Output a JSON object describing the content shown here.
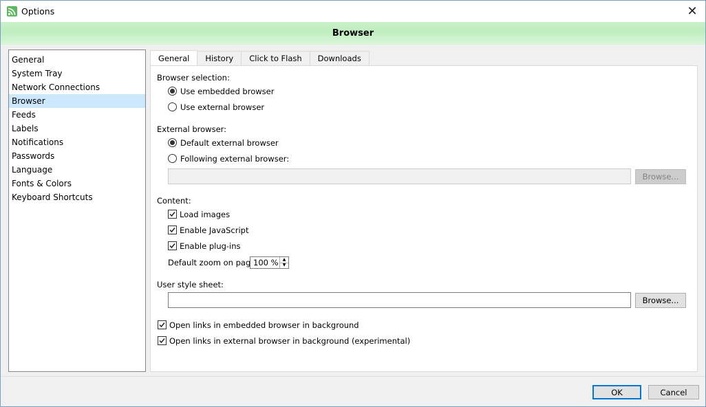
{
  "window": {
    "title": "Options",
    "close_glyph": "✕"
  },
  "header": {
    "title": "Browser"
  },
  "sidebar": {
    "items": [
      {
        "label": "General"
      },
      {
        "label": "System Tray"
      },
      {
        "label": "Network Connections"
      },
      {
        "label": "Browser",
        "selected": true
      },
      {
        "label": "Feeds"
      },
      {
        "label": "Labels"
      },
      {
        "label": "Notifications"
      },
      {
        "label": "Passwords"
      },
      {
        "label": "Language"
      },
      {
        "label": "Fonts & Colors"
      },
      {
        "label": "Keyboard Shortcuts"
      }
    ]
  },
  "tabs": [
    {
      "label": "General",
      "active": true
    },
    {
      "label": "History"
    },
    {
      "label": "Click to Flash"
    },
    {
      "label": "Downloads"
    }
  ],
  "browser_selection": {
    "heading": "Browser selection:",
    "embedded": {
      "label": "Use embedded browser",
      "checked": true
    },
    "external": {
      "label": "Use external browser",
      "checked": false
    }
  },
  "external_browser": {
    "heading": "External browser:",
    "default": {
      "label": "Default external browser",
      "checked": true
    },
    "following": {
      "label": "Following external browser:",
      "checked": false
    },
    "path_value": "",
    "browse_label": "Browse..."
  },
  "content": {
    "heading": "Content:",
    "load_images": {
      "label": "Load images",
      "checked": true
    },
    "enable_javascript": {
      "label": "Enable JavaScript",
      "checked": true
    },
    "enable_plugins": {
      "label": "Enable plug-ins",
      "checked": true
    },
    "zoom_label": "Default zoom on pages:",
    "zoom_value": "100 %"
  },
  "user_style_sheet": {
    "heading": "User style sheet:",
    "value": "",
    "browse_label": "Browse..."
  },
  "background_options": {
    "embedded": {
      "label": "Open links in embedded browser in background",
      "checked": true
    },
    "external": {
      "label": "Open links in external browser in background (experimental)",
      "checked": true
    }
  },
  "footer": {
    "ok_label": "OK",
    "cancel_label": "Cancel"
  },
  "colors": {
    "header_band": "#c9f0c9",
    "selected_item": "#cce8ff",
    "primary_border": "#0078d7"
  }
}
